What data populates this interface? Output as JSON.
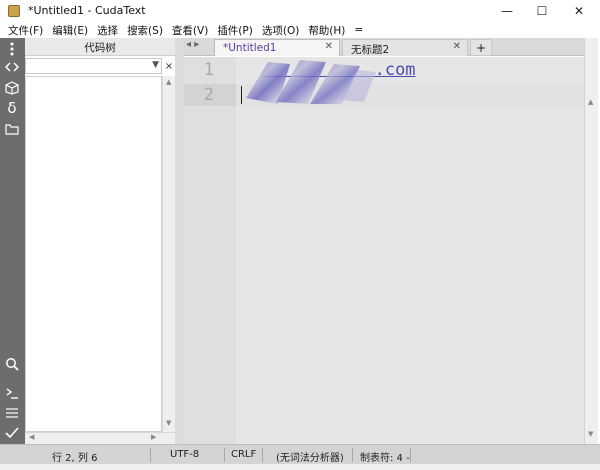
{
  "window": {
    "title": "*Untitled1 - CudaText",
    "controls": {
      "minimize": "—",
      "maximize": "☐",
      "close": "✕"
    }
  },
  "menu": {
    "items": [
      "文件(F)",
      "编辑(E)",
      "选择",
      "搜索(S)",
      "查看(V)",
      "插件(P)",
      "选项(O)",
      "帮助(H)",
      "="
    ]
  },
  "sidebar": {
    "icons": [
      "more-icon",
      "code-tree-icon",
      "project-icon",
      "snippets-icon",
      "folder-icon",
      "search-icon",
      "console-icon",
      "list-icon",
      "check-icon"
    ]
  },
  "code_tree": {
    "title": "代码树",
    "close": "×"
  },
  "tabs": {
    "nav": "◂ ▸",
    "items": [
      {
        "label": "*Untitled1",
        "active": true
      },
      {
        "label": "无标题2",
        "active": false
      }
    ],
    "add": "+",
    "close": "✕"
  },
  "editor": {
    "line_numbers": [
      "1",
      "2"
    ],
    "line1_visible": ".com",
    "line2_visible": ""
  },
  "status": {
    "position": "行 2, 列 6",
    "encoding": "UTF-8",
    "line_ending": "CRLF",
    "lexer": "(无词法分析器)",
    "tab_size": "制表符: 4 -"
  },
  "colors": {
    "sidebar": "#6d6d6d",
    "active_tab_text": "#5a3fa0",
    "link_text": "#4b4bb0"
  }
}
